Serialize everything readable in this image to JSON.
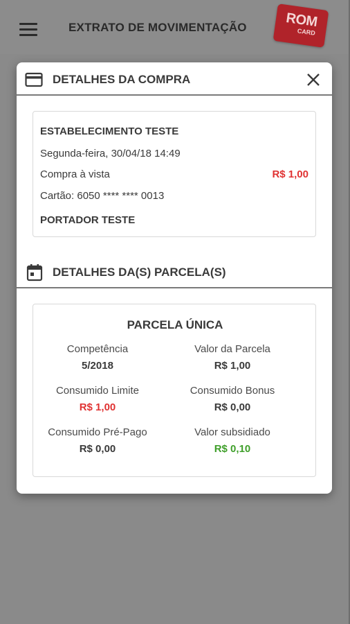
{
  "header": {
    "title": "EXTRATO DE MOVIMENTAÇÃO",
    "logo_line1": "ROM",
    "logo_line2": "CARD"
  },
  "purchase_section": {
    "title": "DETALHES DA COMPRA",
    "establishment": "ESTABELECIMENTO TESTE",
    "datetime": "Segunda-feira, 30/04/18 14:49",
    "type": "Compra à vista",
    "amount": "R$ 1,00",
    "card_number": "Cartão: 6050 **** **** 0013",
    "holder": "PORTADOR TESTE"
  },
  "installments_section": {
    "title": "DETALHES DA(S) PARCELA(S)",
    "installment_title": "PARCELA ÚNICA",
    "fields": [
      {
        "label": "Competência",
        "value": "5/2018",
        "color": "#3a3a3a"
      },
      {
        "label": "Valor da Parcela",
        "value": "R$ 1,00",
        "color": "#3a3a3a"
      },
      {
        "label": "Consumido Limite",
        "value": "R$ 1,00",
        "color": "#e03232"
      },
      {
        "label": "Consumido Bonus",
        "value": "R$ 0,00",
        "color": "#3a3a3a"
      },
      {
        "label": "Consumido Pré-Pago",
        "value": "R$ 0,00",
        "color": "#3a3a3a"
      },
      {
        "label": "Valor subsidiado",
        "value": "R$ 0,10",
        "color": "#3f9f2a"
      }
    ]
  },
  "icons": {
    "menu": "menu-icon",
    "card": "credit-card-icon",
    "close": "close-icon",
    "calendar": "calendar-icon"
  }
}
